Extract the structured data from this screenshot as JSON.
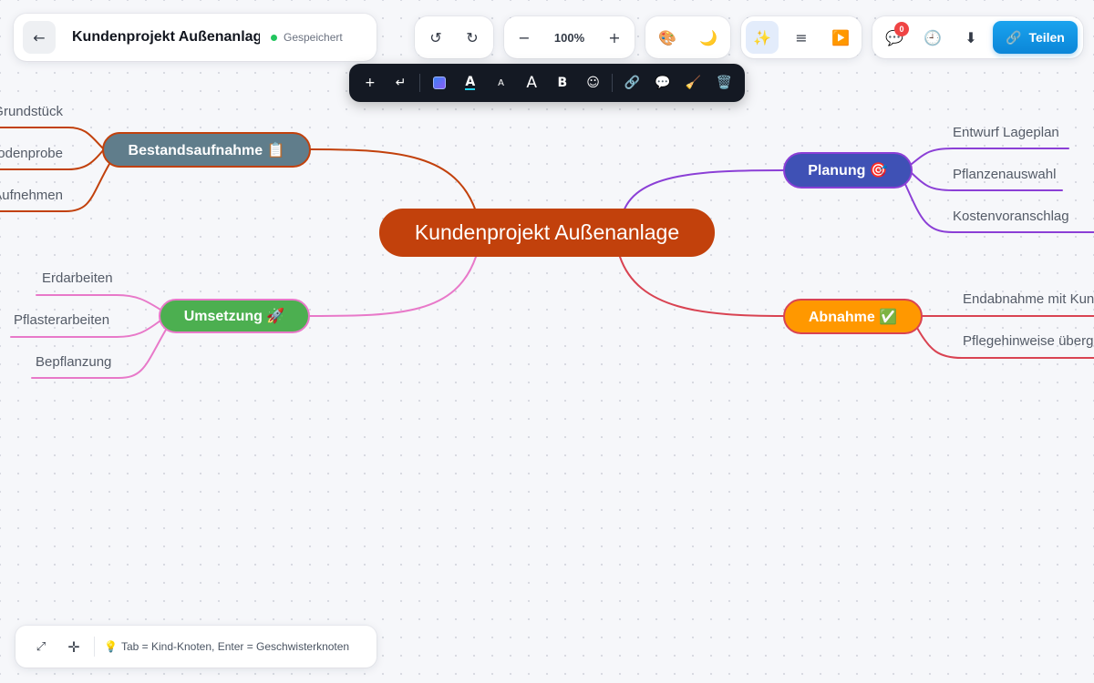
{
  "header": {
    "back_icon": "arrow-left-icon",
    "title": "Kundenprojekt Außenanlage",
    "save_status": "Gespeichert",
    "save_status_color": "#22c55e"
  },
  "toolbar": {
    "undo_icon": "↺",
    "redo_icon": "↻",
    "zoom_out_icon": "−",
    "zoom_level": "100%",
    "zoom_in_icon": "+",
    "theme_icon": "🎨",
    "dark_mode_icon": "🌙",
    "magic_icon": "✨",
    "outline_icon": "≡",
    "present_icon": "▶️",
    "comments_icon": "💬",
    "comments_count": "0",
    "history_icon": "🕘",
    "download_icon": "⬇",
    "share_icon": "🔗",
    "share_label": "Teilen"
  },
  "format_bar": {
    "add_child": "+",
    "add_sibling": "↵",
    "text_color": "A",
    "font_smaller": "A",
    "font_larger": "A",
    "bold": "B",
    "emoji": "☺",
    "link": "🔗",
    "comment": "💬",
    "clear": "🧹",
    "delete": "🗑️"
  },
  "mindmap": {
    "root": {
      "label": "Kundenprojekt Außenanlage",
      "color": "#c2410c"
    },
    "branches": {
      "bestand": {
        "label": "Bestandsaufnahme 📋",
        "color": "#607d8b",
        "edge": "#c2410c",
        "children": [
          "Grundstück",
          "Bodenprobe",
          "Aufnehmen"
        ]
      },
      "umsetzung": {
        "label": "Umsetzung 🚀",
        "color": "#4caf50",
        "edge": "#e879c9",
        "children": [
          "Erdarbeiten",
          "Pflasterarbeiten",
          "Bepflanzung"
        ]
      },
      "planung": {
        "label": "Planung 🎯",
        "color": "#3f51b5",
        "edge": "#8b3fd6",
        "children": [
          "Entwurf Lageplan",
          "Pflanzenauswahl",
          "Kostenvoranschlag"
        ]
      },
      "abnahme": {
        "label": "Abnahme ✅",
        "color": "#ff9800",
        "edge": "#d94352",
        "children": [
          "Endabnahme mit Kunde",
          "Pflegehinweise übergeben"
        ]
      }
    }
  },
  "footer": {
    "fit_icon": "⤢",
    "center_icon": "✛",
    "hint_icon": "💡",
    "hint_text": "Tab = Kind-Knoten, Enter = Geschwisterknoten"
  }
}
